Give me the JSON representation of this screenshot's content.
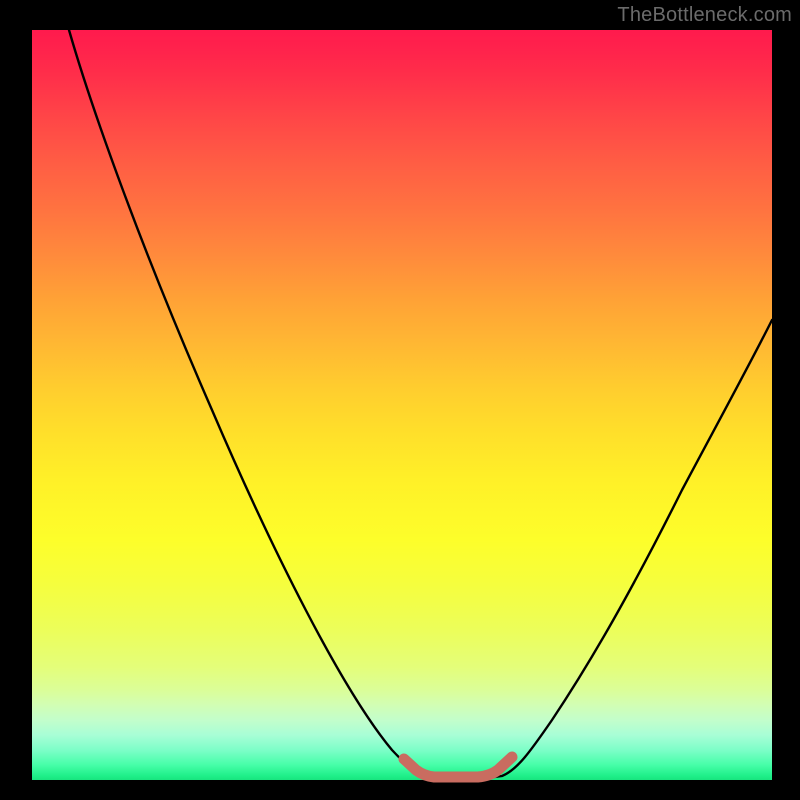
{
  "watermark": "TheBottleneck.com",
  "chart_data": {
    "type": "line",
    "title": "",
    "xlabel": "",
    "ylabel": "",
    "xlim": [
      0,
      100
    ],
    "ylim": [
      0,
      100
    ],
    "grid": false,
    "legend": false,
    "series": [
      {
        "name": "bottleneck-curve",
        "x": [
          5,
          10,
          15,
          20,
          25,
          30,
          35,
          40,
          45,
          50,
          52,
          54,
          56,
          58,
          60,
          62,
          64,
          68,
          72,
          76,
          80,
          84,
          88,
          92,
          96,
          100
        ],
        "y": [
          100,
          92,
          83,
          74,
          65,
          56,
          47,
          37,
          27,
          16,
          10,
          5,
          2,
          1,
          1,
          1,
          2,
          6,
          12,
          19,
          27,
          35,
          43,
          50,
          56,
          62
        ]
      },
      {
        "name": "optimal-marker",
        "x": [
          54,
          55,
          56,
          57,
          58,
          59,
          60,
          61,
          62,
          63,
          64
        ],
        "y": [
          3.5,
          2.2,
          1.6,
          1.3,
          1.2,
          1.2,
          1.2,
          1.3,
          1.6,
          2.2,
          3.5
        ]
      }
    ],
    "colors": {
      "bottleneck_curve": "#000000",
      "optimal_marker": "#c96c60",
      "gradient_top": "#ff1a4d",
      "gradient_bottom": "#18e47e"
    }
  }
}
